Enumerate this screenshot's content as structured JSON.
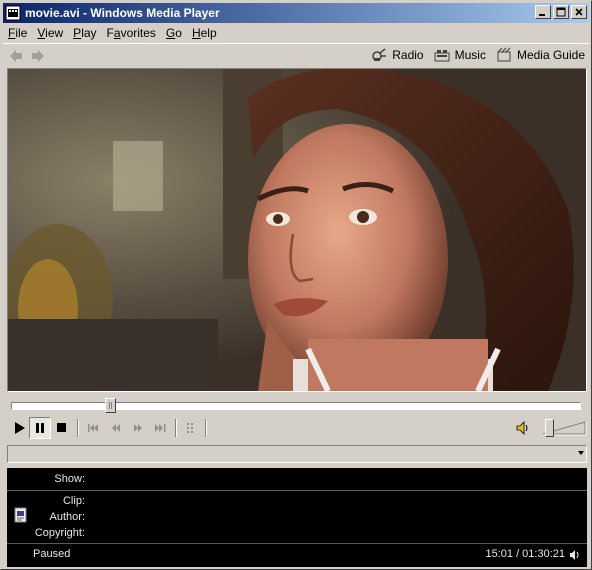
{
  "window": {
    "title": "movie.avi - Windows Media Player",
    "title_gradient": [
      "#0a246a",
      "#a6caf0"
    ]
  },
  "menu": {
    "items": [
      {
        "label": "File",
        "accel": "F",
        "rest": "ile"
      },
      {
        "label": "View",
        "accel": "V",
        "rest": "iew"
      },
      {
        "label": "Play",
        "accel": "P",
        "rest": "lay"
      },
      {
        "label": "Favorites",
        "accel": "a",
        "pre": "F",
        "rest": "vorites"
      },
      {
        "label": "Go",
        "accel": "G",
        "rest": "o"
      },
      {
        "label": "Help",
        "accel": "H",
        "rest": "elp"
      }
    ]
  },
  "nav": {
    "links": [
      {
        "label": "Radio",
        "icon": "radio-icon"
      },
      {
        "label": "Music",
        "icon": "music-icon"
      },
      {
        "label": "Media Guide",
        "icon": "media-guide-icon"
      }
    ]
  },
  "seek": {
    "position_fraction": 0.167
  },
  "volume": {
    "level_fraction": 0.1
  },
  "info": {
    "show_label": "Show:",
    "clip_label": "Clip:",
    "author_label": "Author:",
    "copyright_label": "Copyright:",
    "status": "Paused",
    "time": "15:01 / 01:30:21"
  }
}
